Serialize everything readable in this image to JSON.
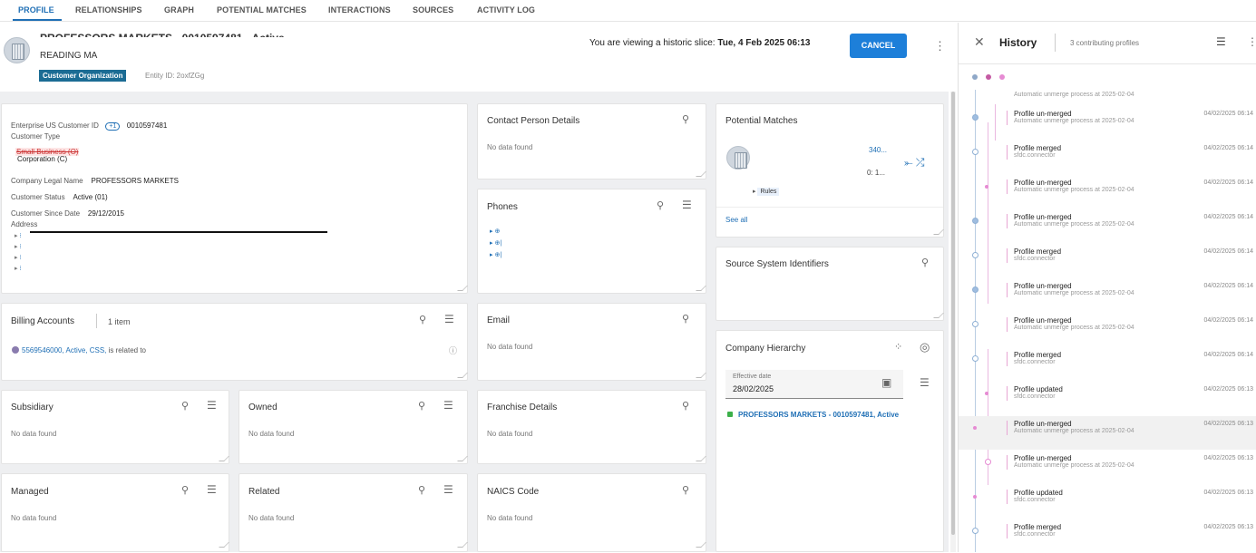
{
  "tabs": [
    {
      "label": "PROFILE",
      "active": true
    },
    {
      "label": "RELATIONSHIPS"
    },
    {
      "label": "GRAPH"
    },
    {
      "label": "POTENTIAL MATCHES"
    },
    {
      "label": "INTERACTIONS"
    },
    {
      "label": "SOURCES"
    },
    {
      "label": "ACTIVITY LOG"
    }
  ],
  "header": {
    "title": "PROFESSORS MARKETS - 0010597481 - Active",
    "location": "READING MA",
    "badge": "Customer Organization",
    "entity_id": "Entity ID: 2oxfZGg",
    "historic_prefix": "You are viewing a historic slice: ",
    "historic_date": "Tue, 4 Feb 2025 06:13",
    "cancel_label": "CANCEL"
  },
  "profile": {
    "enterprise_id_label": "Enterprise US Customer ID",
    "enterprise_id_count": "+1",
    "enterprise_id_value": "0010597481",
    "customer_type_label": "Customer Type",
    "customer_type_old": "Small Business (O)",
    "customer_type_new": "Corporation (C)",
    "legal_name_label": "Company Legal Name",
    "legal_name_value": "PROFESSORS MARKETS",
    "status_label": "Customer Status",
    "status_value": "Active (01)",
    "since_label": "Customer Since Date",
    "since_value": "29/12/2015",
    "address_label": "Address"
  },
  "cards": {
    "contact": {
      "title": "Contact Person Details",
      "empty": "No data found"
    },
    "phones": {
      "title": "Phones"
    },
    "potential": {
      "title": "Potential Matches",
      "match_line1": "340...",
      "match_line2": "0: 1...",
      "rules": "Rules",
      "see_all": "See all"
    },
    "source": {
      "title": "Source System Identifiers"
    },
    "billing": {
      "title": "Billing Accounts",
      "count": "1 item",
      "item": "5569546000, Active, CSS,",
      "item_suffix": " is related to"
    },
    "email": {
      "title": "Email",
      "empty": "No data found"
    },
    "hierarchy": {
      "title": "Company Hierarchy",
      "date_label": "Effective date",
      "date_value": "28/02/2025",
      "entity": "PROFESSORS MARKETS - 0010597481, Active"
    },
    "subsidiary": {
      "title": "Subsidiary",
      "empty": "No data found"
    },
    "owned": {
      "title": "Owned",
      "empty": "No data found"
    },
    "franchise": {
      "title": "Franchise Details",
      "empty": "No data found"
    },
    "managed": {
      "title": "Managed",
      "empty": "No data found"
    },
    "related": {
      "title": "Related",
      "empty": "No data found"
    },
    "naics": {
      "title": "NAICS Code",
      "empty": "No data found"
    }
  },
  "history": {
    "title": "History",
    "subtitle": "3 contributing profiles",
    "dot_colors": [
      "#8fa8c8",
      "#c45aa3",
      "#e68bd3"
    ],
    "top_sub": "Automatic unmerge process at 2025-02-04",
    "items": [
      {
        "event": "Profile un-merged",
        "sub": "Automatic unmerge process at 2025-02-04",
        "date": "04/02/2025 06:14"
      },
      {
        "event": "Profile merged",
        "sub": "sfdc.connector",
        "date": "04/02/2025 06:14"
      },
      {
        "event": "Profile un-merged",
        "sub": "Automatic unmerge process at 2025-02-04",
        "date": "04/02/2025 06:14"
      },
      {
        "event": "Profile un-merged",
        "sub": "Automatic unmerge process at 2025-02-04",
        "date": "04/02/2025 06:14"
      },
      {
        "event": "Profile merged",
        "sub": "sfdc.connector",
        "date": "04/02/2025 06:14"
      },
      {
        "event": "Profile un-merged",
        "sub": "Automatic unmerge process at 2025-02-04",
        "date": "04/02/2025 06:14"
      },
      {
        "event": "Profile un-merged",
        "sub": "Automatic unmerge process at 2025-02-04",
        "date": "04/02/2025 06:14"
      },
      {
        "event": "Profile merged",
        "sub": "sfdc.connector",
        "date": "04/02/2025 06:14"
      },
      {
        "event": "Profile updated",
        "sub": "sfdc.connector",
        "date": "04/02/2025 06:13"
      },
      {
        "event": "Profile un-merged",
        "sub": "Automatic unmerge process at 2025-02-04",
        "date": "04/02/2025 06:13",
        "selected": true
      },
      {
        "event": "Profile un-merged",
        "sub": "Automatic unmerge process at 2025-02-04",
        "date": "04/02/2025 06:13"
      },
      {
        "event": "Profile updated",
        "sub": "sfdc.connector",
        "date": "04/02/2025 06:13"
      },
      {
        "event": "Profile merged",
        "sub": "sfdc.connector",
        "date": "04/02/2025 06:13"
      }
    ]
  },
  "colors": {
    "accent": "#1f6fb5",
    "badge": "#1b6c94",
    "cancel": "#1d7fd9",
    "status_green": "#3cb04a"
  }
}
